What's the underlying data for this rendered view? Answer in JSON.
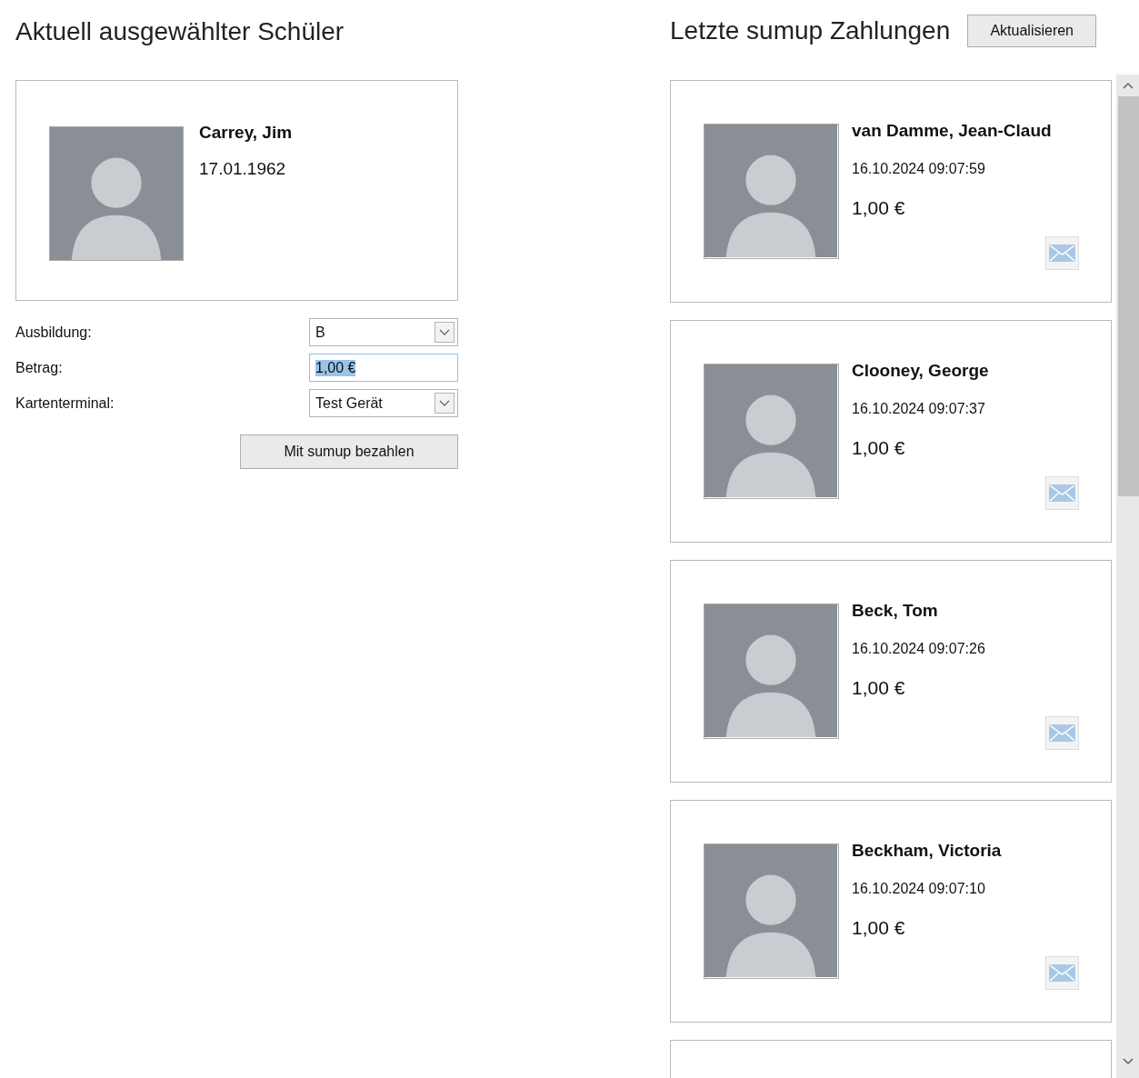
{
  "student": {
    "title": "Aktuell ausgewählter Schüler",
    "name": "Carrey, Jim",
    "birthdate": "17.01.1962"
  },
  "form": {
    "fields": [
      {
        "kind": "dropdown",
        "label": "Ausbildung:",
        "value": "B",
        "focused": false
      },
      {
        "kind": "text",
        "label": "Betrag:",
        "value": "1,00 €",
        "focused": true
      },
      {
        "kind": "dropdown",
        "label": "Kartenterminal:",
        "value": "Test Gerät",
        "focused": false
      }
    ],
    "submit_button": "Mit sumup bezahlen"
  },
  "payments": {
    "title": "Letzte sumup Zahlungen",
    "refresh_button": "Aktualisieren",
    "items": [
      {
        "name": "van Damme, Jean-Claud",
        "time": "16.10.2024 09:07:59",
        "amount": "1,00 €"
      },
      {
        "name": "Clooney, George",
        "time": "16.10.2024 09:07:37",
        "amount": "1,00 €"
      },
      {
        "name": "Beck, Tom",
        "time": "16.10.2024 09:07:26",
        "amount": "1,00 €"
      },
      {
        "name": "Beckham, Victoria",
        "time": "16.10.2024 09:07:10",
        "amount": "1,00 €"
      }
    ]
  }
}
